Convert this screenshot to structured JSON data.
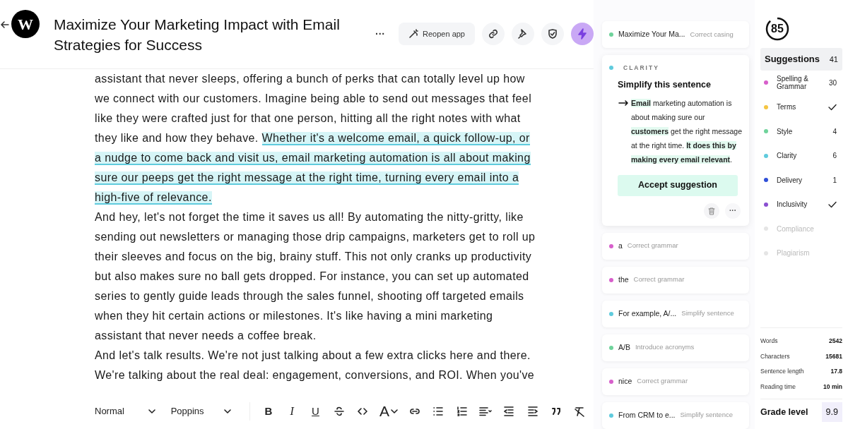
{
  "header": {
    "logo_letter": "W",
    "title": "Maximize Your Marketing Impact with Email Strategies for Success",
    "reopen_button": "Reopen app",
    "more_button": "···",
    "lightning_active": true
  },
  "editor": {
    "paragraphs": [
      [
        {
          "text": "assistant that never sleeps, offering a bunch of perks that can totally level up how we connect with our customers. Imagine being able to send out messages that feel like they were crafted just for that one person, hitting all the right notes with what they like and how they behave. ",
          "highlighted": false
        },
        {
          "text": "Whether it's a welcome email, a quick follow-up, or a nudge to come back and visit us, email marketing automation is all about making sure our peeps get the right message at the right time, turning every email into a high-five of relevance.",
          "highlighted": true
        }
      ],
      [
        {
          "text": "And hey, let's not forget the time it saves us all! By automating the nitty-gritty, like sending out newsletters or managing those drip campaigns, marketers get to roll up their sleeves and focus on the big, brainy stuff. This not only cranks up productivity but also makes sure no ball gets dropped. For instance, you can set up automated series to gently guide leads through the sales funnel, shooting off targeted emails when they hit certain actions or milestones. It's like having a mini marketing assistant that never needs a coffee break.",
          "highlighted": false
        }
      ],
      [
        {
          "text": "And let's talk results. We're not just talking about a few extra clicks here and there. We're talking about the real deal: engagement, conversions, and ROI. When you've",
          "highlighted": false
        }
      ]
    ]
  },
  "toolbar": {
    "style_select": "Normal",
    "font_select": "Poppins",
    "buttons": [
      {
        "kind": "bold",
        "label": "B"
      },
      {
        "kind": "italic",
        "label": "I"
      },
      {
        "kind": "underline",
        "label": "U"
      },
      {
        "kind": "strike"
      },
      {
        "kind": "code"
      },
      {
        "kind": "color",
        "label": "A"
      },
      {
        "kind": "link"
      },
      {
        "kind": "bullets"
      },
      {
        "kind": "numbers"
      },
      {
        "kind": "align"
      },
      {
        "kind": "outdent"
      },
      {
        "kind": "indent"
      },
      {
        "kind": "quote"
      },
      {
        "kind": "clear"
      }
    ]
  },
  "suggestions": [
    {
      "kind": "collapsed",
      "color": "#6fd39b",
      "text": "Maximize Your Ma...",
      "label": "Correct casing"
    },
    {
      "kind": "expanded",
      "color": "#5fcbdd",
      "category": "CLARITY",
      "title": "Simplify this sentence",
      "body": [
        {
          "text": "Email",
          "highlighted": true
        },
        {
          "text": " marketing automation is about making sure our ",
          "highlighted": false
        },
        {
          "text": "customers",
          "highlighted": true
        },
        {
          "text": " get the right message at the right time. ",
          "highlighted": false
        },
        {
          "text": "It does this by making every email relevant",
          "highlighted": true
        },
        {
          "text": ".",
          "highlighted": false
        }
      ],
      "accept": "Accept suggestion",
      "more": "···"
    },
    {
      "kind": "collapsed",
      "color": "#d75fcb",
      "text": "a",
      "label": "Correct grammar"
    },
    {
      "kind": "collapsed",
      "color": "#d75fcb",
      "text": "the",
      "label": "Correct grammar"
    },
    {
      "kind": "collapsed",
      "color": "#5fcbdd",
      "text": "For example, A/...",
      "label": "Simplify sentence"
    },
    {
      "kind": "collapsed",
      "color": "#6fd39b",
      "text": "A/B",
      "label": "Introduce acronyms"
    },
    {
      "kind": "collapsed",
      "color": "#d75fcb",
      "text": "nice",
      "label": "Correct grammar"
    },
    {
      "kind": "collapsed",
      "color": "#5fcbdd",
      "text": "From CRM to e...",
      "label": "Simplify sentence"
    }
  ],
  "score": {
    "value": "85",
    "level": 0.88
  },
  "categories": {
    "header": {
      "label": "Suggestions",
      "count": "41",
      "selected": true
    },
    "items": [
      {
        "name": "Spelling & Grammar",
        "color": "#d75fcb",
        "count": "30",
        "disabled": false
      },
      {
        "name": "Terms",
        "color": "#f5c542",
        "done": true,
        "disabled": false
      },
      {
        "name": "Style",
        "color": "#6fd39b",
        "count": "4",
        "disabled": false
      },
      {
        "name": "Clarity",
        "color": "#5fcbdd",
        "count": "6",
        "disabled": false
      },
      {
        "name": "Delivery",
        "color": "#2f4fd8",
        "count": "1",
        "disabled": false
      },
      {
        "name": "Inclusivity",
        "color": "#8a4fd0",
        "done": true,
        "disabled": false
      },
      {
        "name": "Compliance",
        "color": "#e5e5e5",
        "disabled": true
      },
      {
        "name": "Plagiarism",
        "color": "#e5e5e5",
        "disabled": true
      }
    ]
  },
  "stats": [
    {
      "label": "Words",
      "value": "2542"
    },
    {
      "label": "Characters",
      "value": "15681"
    },
    {
      "label": "Sentence length",
      "value": "17.8"
    },
    {
      "label": "Reading time",
      "value": "10 min"
    }
  ],
  "grade": {
    "label": "Grade level",
    "value": "9.9"
  }
}
